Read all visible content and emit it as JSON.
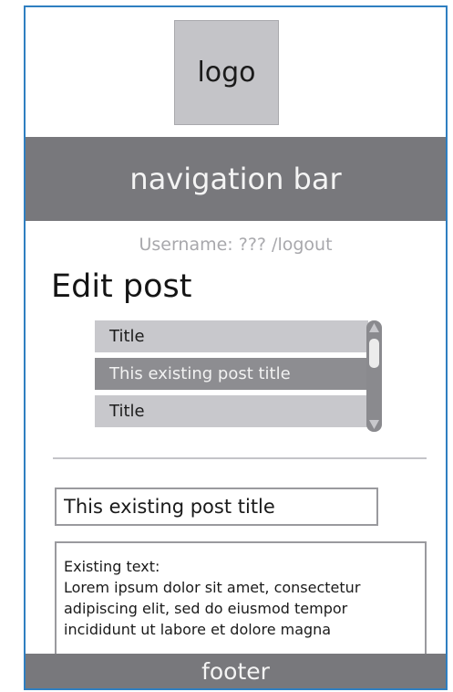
{
  "logo": {
    "label": "logo"
  },
  "navigation": {
    "label": "navigation bar"
  },
  "user": {
    "line": "Username: ??? /logout"
  },
  "page": {
    "title": "Edit post"
  },
  "post_list": {
    "items": [
      {
        "label": "Title"
      },
      {
        "label": "This existing post title"
      },
      {
        "label": "Title"
      }
    ]
  },
  "editor": {
    "title_value": "This existing post title",
    "body_lines": [
      "Existing text:",
      "Lorem ipsum dolor sit amet, consectetur",
      "adipiscing elit, sed do eiusmod tempor",
      "incididunt ut labore et dolore magna"
    ]
  },
  "footer": {
    "label": "footer"
  },
  "colors": {
    "frame_border": "#2f7fc1",
    "bar_gray": "#78787c",
    "selected_item": "#8d8d91",
    "list_item": "#c8c8cc"
  }
}
